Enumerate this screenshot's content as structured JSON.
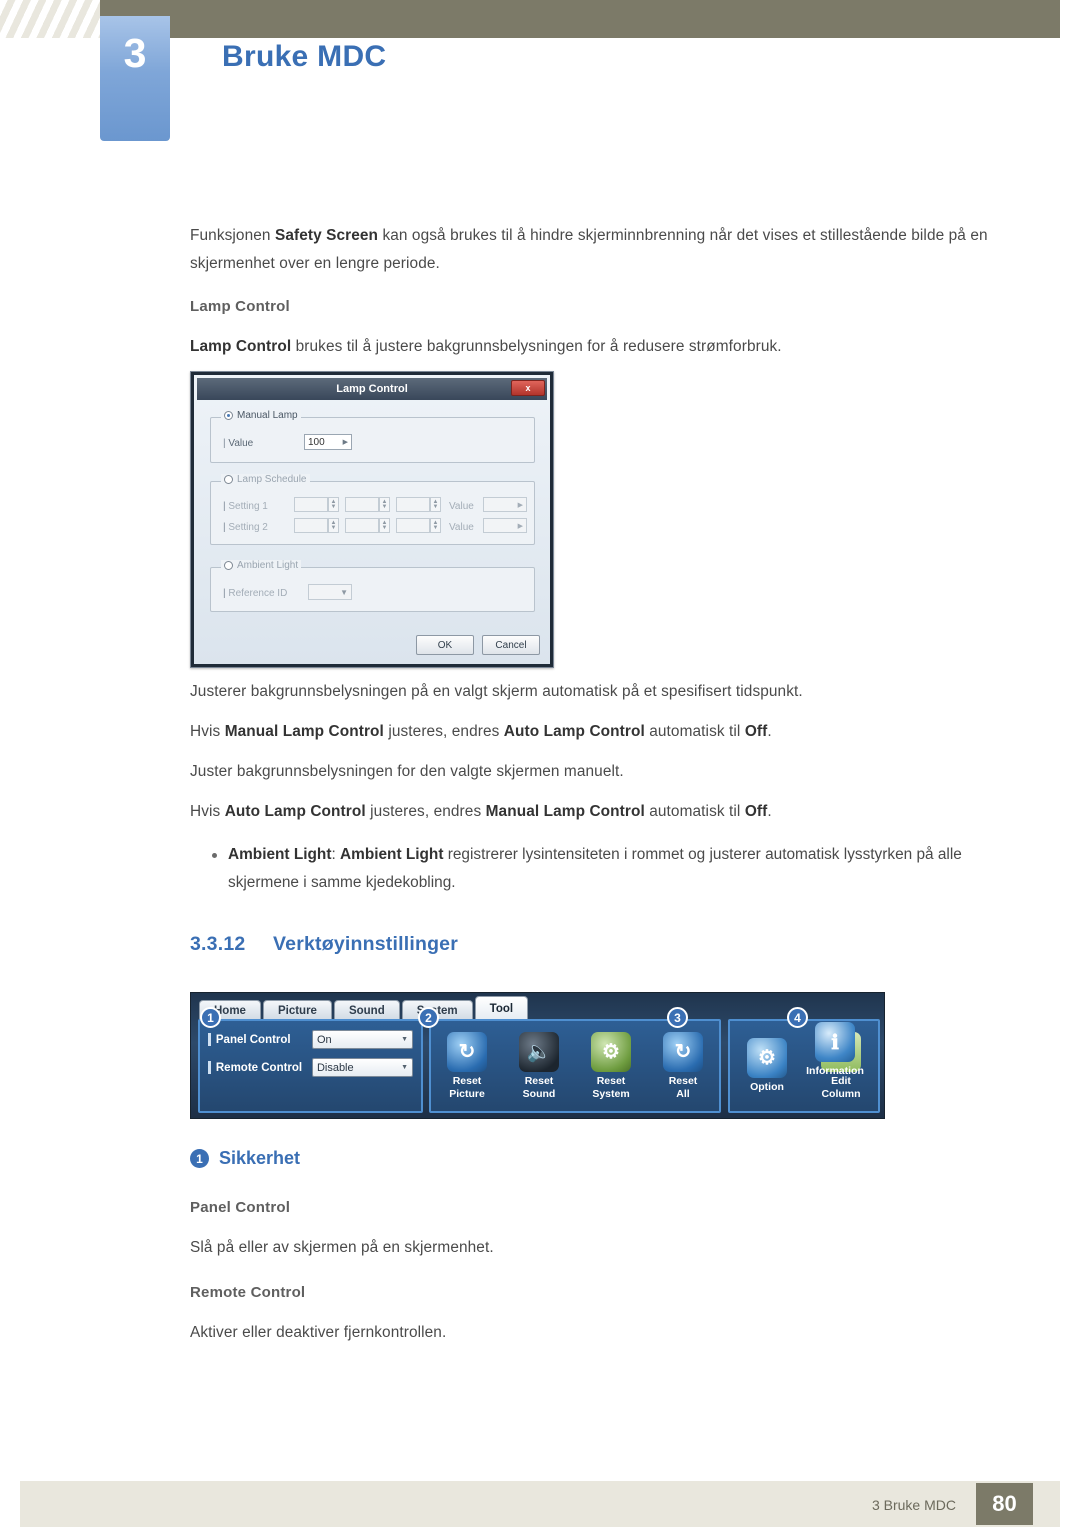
{
  "header": {
    "chapter_number": "3",
    "chapter_title": "Bruke MDC"
  },
  "body": {
    "intro_html": "Funksjonen <b>Safety Screen</b> kan også brukes til å hindre skjerminnbrenning når det vises et stillestående bilde på en skjermenhet over en lengre periode.",
    "lamp_control_heading": "Lamp Control",
    "lamp_control_desc_html": "<b>Lamp Control</b> brukes til å justere bakgrunnsbelysningen for å redusere strømforbruk.",
    "after_dialog_1": "Justerer bakgrunnsbelysningen på en valgt skjerm automatisk på et spesifisert tidspunkt.",
    "after_dialog_2_html": "Hvis <b>Manual Lamp Control</b> justeres, endres <b>Auto Lamp Control</b> automatisk til <b>Off</b>.",
    "after_dialog_3": "Juster bakgrunnsbelysningen for den valgte skjermen manuelt.",
    "after_dialog_4_html": "Hvis <b>Auto Lamp Control</b> justeres, endres <b>Manual Lamp Control</b> automatisk til <b>Off</b>.",
    "bullet_ambient_html": "<b>Ambient Light</b>: <b>Ambient Light</b> registrerer lysintensiteten i rommet og justerer automatisk lysstyrken på alle skjermene i samme kjedekobling."
  },
  "section": {
    "number": "3.3.12",
    "title": "Verktøyinnstillinger"
  },
  "callout": {
    "badge": "1",
    "title": "Sikkerhet"
  },
  "security": {
    "panel_control_heading": "Panel Control",
    "panel_control_desc": "Slå på eller av skjermen på en skjermenhet.",
    "remote_control_heading": "Remote Control",
    "remote_control_desc": "Aktiver eller deaktiver fjernkontrollen."
  },
  "lamp_dialog": {
    "title": "Lamp Control",
    "close_label": "x",
    "manual_lamp_label": "Manual Lamp",
    "value_label": "Value",
    "value": "100",
    "lamp_schedule_label": "Lamp Schedule",
    "setting1_label": "Setting 1",
    "setting2_label": "Setting 2",
    "schedule_value_label": "Value",
    "ambient_light_label": "Ambient Light",
    "reference_id_label": "Reference ID",
    "ok_label": "OK",
    "cancel_label": "Cancel"
  },
  "tool_strip": {
    "tabs": [
      {
        "label": "Home",
        "active": false
      },
      {
        "label": "Picture",
        "active": false
      },
      {
        "label": "Sound",
        "active": false
      },
      {
        "label": "System",
        "active": false
      },
      {
        "label": "Tool",
        "active": true
      }
    ],
    "badges": [
      "1",
      "2",
      "3",
      "4"
    ],
    "panel_group": {
      "rows": [
        {
          "label": "Panel Control",
          "value": "On"
        },
        {
          "label": "Remote Control",
          "value": "Disable"
        }
      ]
    },
    "reset_group": [
      {
        "label": "Reset\nPicture",
        "icon": "reset-picture-icon"
      },
      {
        "label": "Reset\nSound",
        "icon": "reset-sound-icon"
      },
      {
        "label": "Reset\nSystem",
        "icon": "reset-system-icon"
      },
      {
        "label": "Reset\nAll",
        "icon": "reset-all-icon"
      }
    ],
    "option_group": [
      {
        "label": "Option",
        "icon": "option-icon"
      },
      {
        "label": "Edit\nColumn",
        "icon": "edit-column-icon"
      }
    ],
    "info_group": [
      {
        "label": "Information",
        "icon": "information-icon"
      }
    ]
  },
  "footer": {
    "text": "3 Bruke MDC",
    "page": "80"
  },
  "colors": {
    "accent_blue": "#3a6fb4",
    "header_band": "#7c7a68",
    "footer_band": "#e9e7dd",
    "body_text": "#4a4a4a"
  }
}
